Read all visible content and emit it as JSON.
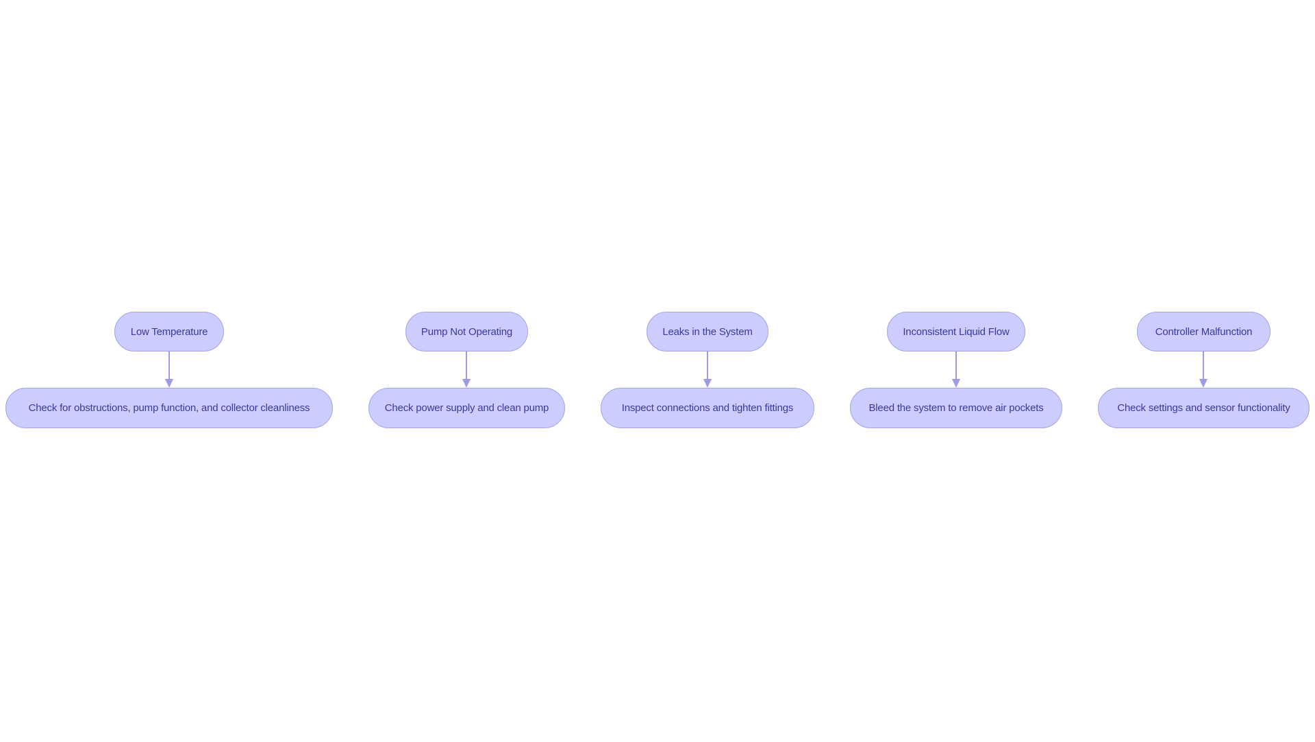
{
  "diagram": {
    "type": "flowchart",
    "direction": "top-down",
    "colors": {
      "node_fill": "#ccccff",
      "node_border": "#a3a3e6",
      "text": "#3a3a9e",
      "edge": "#9b9be6"
    },
    "problems": [
      {
        "id": "p1",
        "label": "Low Temperature"
      },
      {
        "id": "p2",
        "label": "Pump Not Operating"
      },
      {
        "id": "p3",
        "label": "Leaks in the System"
      },
      {
        "id": "p4",
        "label": "Inconsistent Liquid Flow"
      },
      {
        "id": "p5",
        "label": "Controller Malfunction"
      }
    ],
    "solutions": [
      {
        "id": "s1",
        "label": "Check for obstructions, pump function, and collector cleanliness"
      },
      {
        "id": "s2",
        "label": "Check power supply and clean pump"
      },
      {
        "id": "s3",
        "label": "Inspect connections and tighten fittings"
      },
      {
        "id": "s4",
        "label": "Bleed the system to remove air pockets"
      },
      {
        "id": "s5",
        "label": "Check settings and sensor functionality"
      }
    ],
    "edges": [
      {
        "from": "p1",
        "to": "s1"
      },
      {
        "from": "p2",
        "to": "s2"
      },
      {
        "from": "p3",
        "to": "s3"
      },
      {
        "from": "p4",
        "to": "s4"
      },
      {
        "from": "p5",
        "to": "s5"
      }
    ]
  }
}
